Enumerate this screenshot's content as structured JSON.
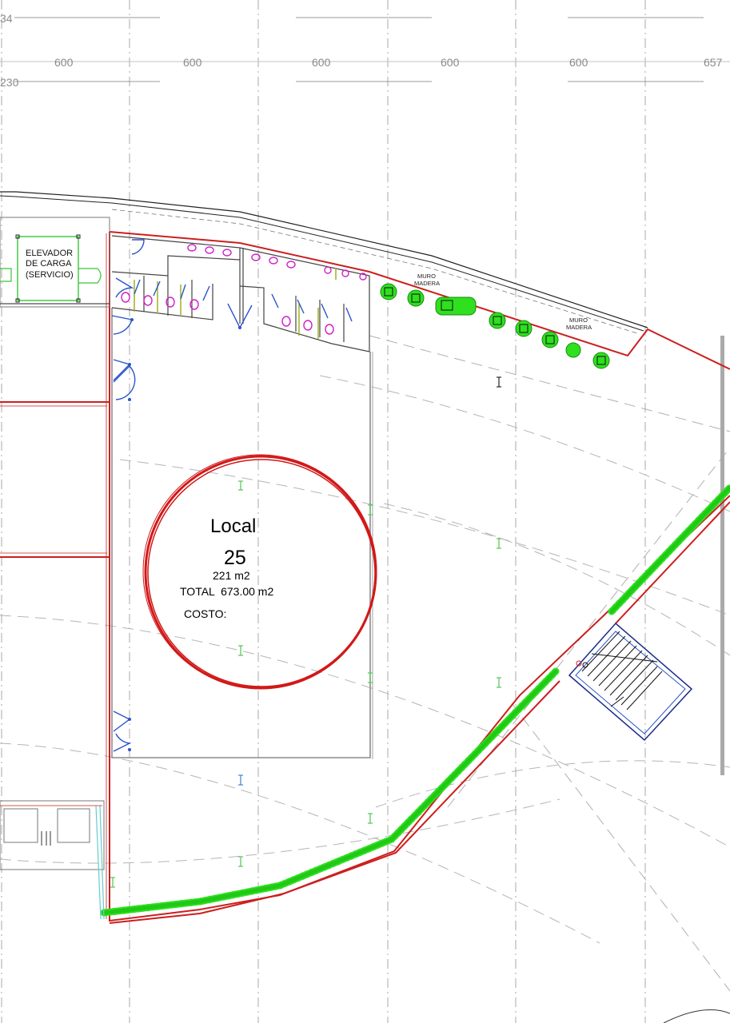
{
  "dimensions": {
    "top_left_a": "34",
    "top_left_b": "230",
    "bays": [
      "600",
      "600",
      "600",
      "600",
      "600",
      "657"
    ]
  },
  "elevator": {
    "line1": "ELEVADOR",
    "line2": "DE CARGA",
    "line3": "(SERVICIO)"
  },
  "walls": {
    "muro_1_line1": "MURO",
    "muro_1_line2": "MADERA",
    "muro_2_line1": "MURO",
    "muro_2_line2": "MADERA"
  },
  "local": {
    "name": "Local",
    "number": "25",
    "area": "221 m2",
    "total": "TOTAL  673.00 m2",
    "cost": "COSTO:"
  },
  "colors": {
    "outline_red": "#cc1f1f",
    "plants_green": "#22e01a",
    "doors_blue": "#2a55c8",
    "fixtures_magenta": "#d020c8",
    "grid_gray": "#9a9a9a",
    "stair_navy": "#1a2a8a"
  }
}
